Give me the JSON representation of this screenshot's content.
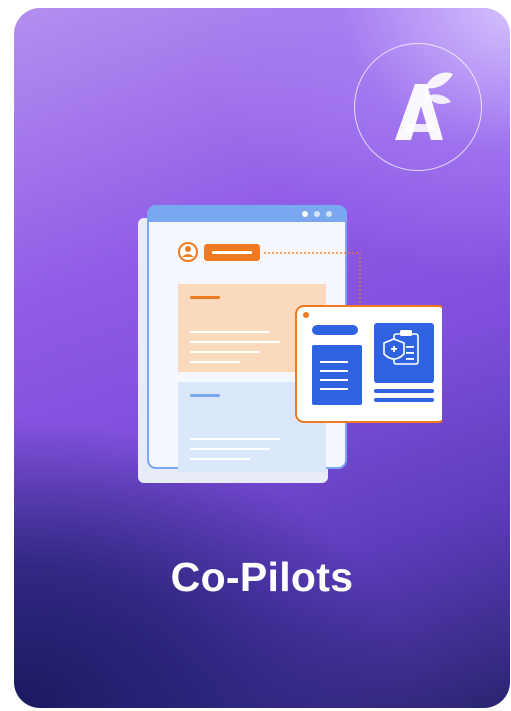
{
  "card": {
    "title": "Co-Pilots",
    "logo_icon": "leaf-a-logo-icon",
    "illustration_icon": "document-medical-record-icon"
  },
  "colors": {
    "accent_orange": "#f07a22",
    "accent_blue": "#2f63e0",
    "window_header_blue": "#7aa8f0",
    "text_white": "#ffffff"
  }
}
